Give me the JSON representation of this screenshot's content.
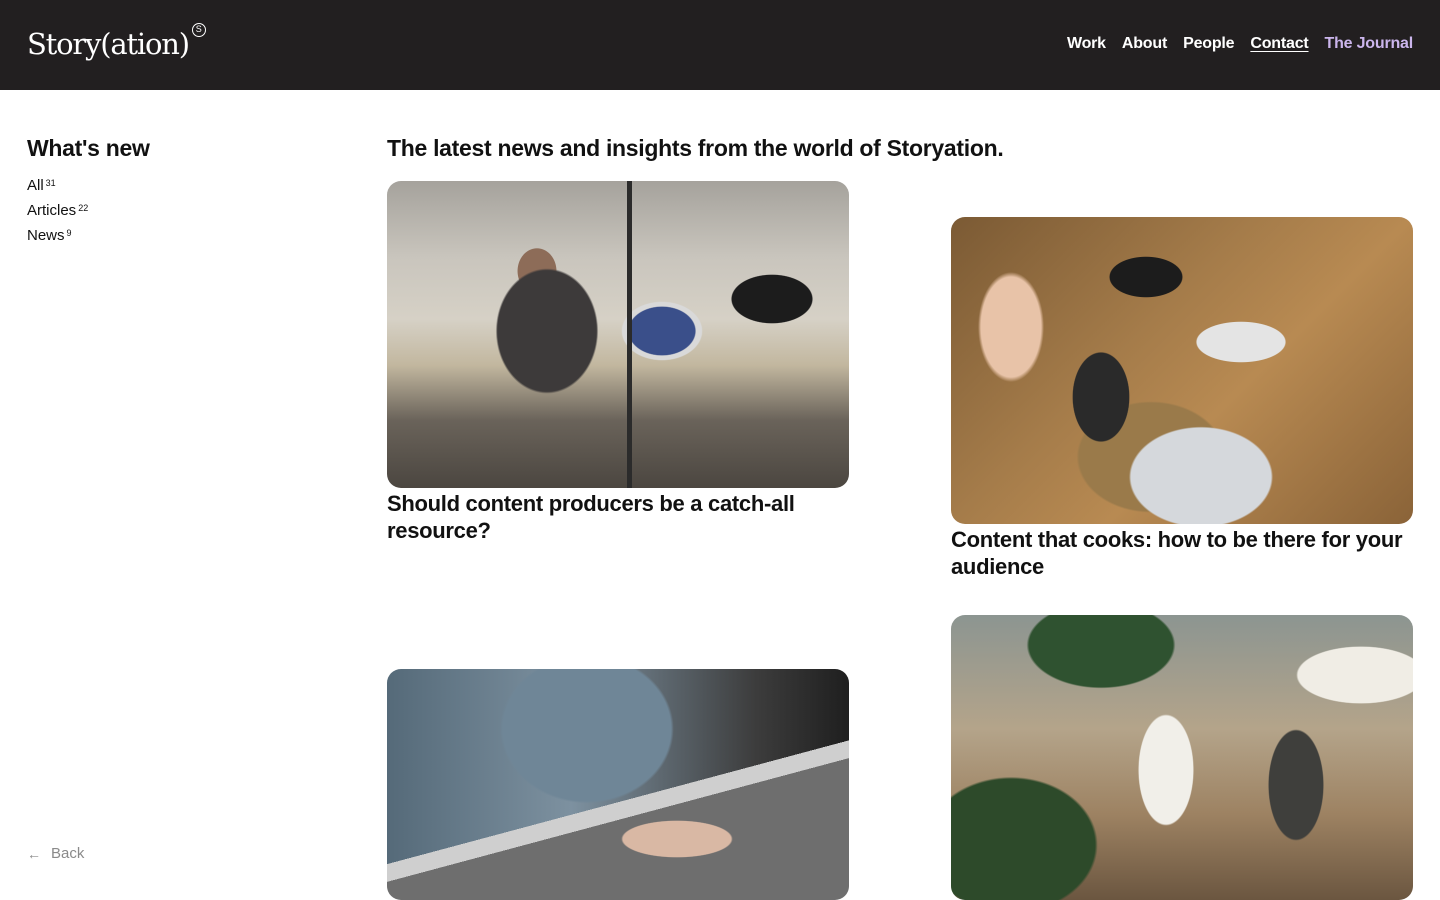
{
  "header": {
    "logo_text": "Story(ation)",
    "logo_mark": "S",
    "nav": [
      {
        "label": "Work"
      },
      {
        "label": "About"
      },
      {
        "label": "People"
      },
      {
        "label": "Contact"
      },
      {
        "label": "The Journal"
      }
    ],
    "accent_color": "#cbb5ec",
    "background_color": "#221f20"
  },
  "sidebar": {
    "title": "What's new",
    "filters": [
      {
        "label": "All",
        "count": "31"
      },
      {
        "label": "Articles",
        "count": "22"
      },
      {
        "label": "News",
        "count": "9"
      }
    ],
    "back_label": "Back",
    "back_icon": "arrow-left-icon"
  },
  "main": {
    "intro": "The latest news and insights from the world of Storyation.",
    "cards": [
      {
        "title": "Should content producers be a catch-all resource?",
        "image": "video-interview-photo"
      },
      {
        "title": "Content that cooks: how to be there for your audience",
        "image": "phones-food-photo"
      },
      {
        "title": "",
        "image": "laptop-writing-photo"
      },
      {
        "title": "",
        "image": "meeting-cafe-photo"
      }
    ]
  }
}
